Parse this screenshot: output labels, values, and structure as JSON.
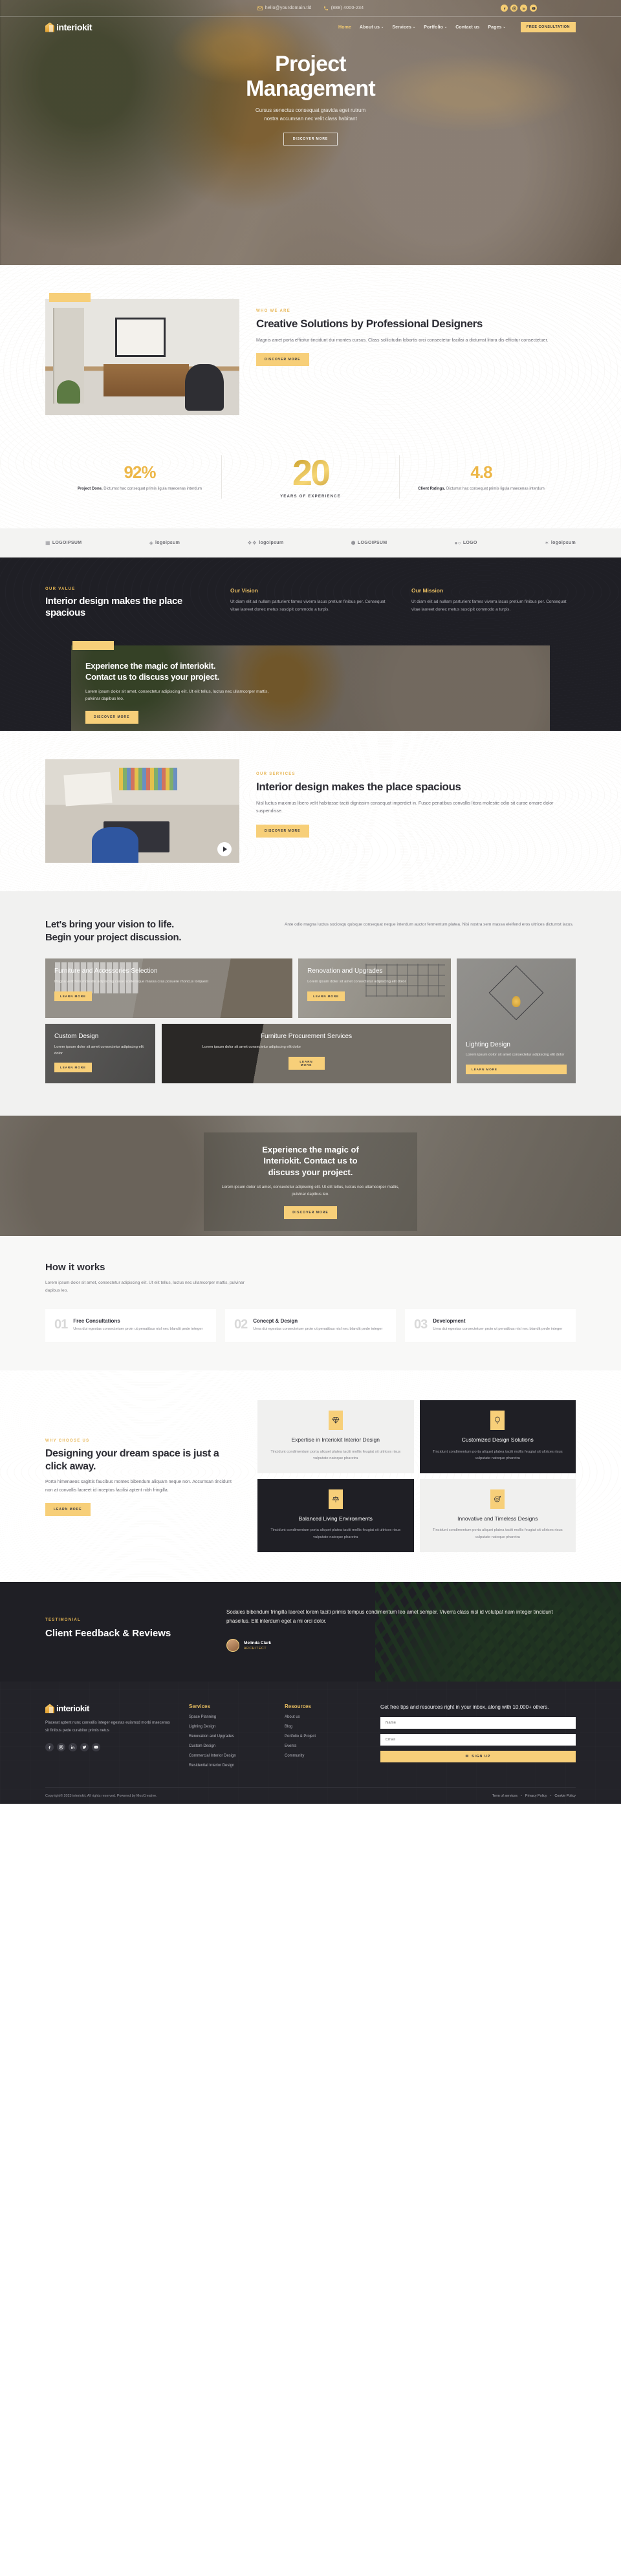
{
  "topbar": {
    "email": "hello@yourdomain.tld",
    "phone": "(888) 4000-234",
    "social": [
      "facebook-icon",
      "instagram-icon",
      "linkedin-icon",
      "youtube-icon"
    ]
  },
  "brand": {
    "name": "interiokit"
  },
  "nav": {
    "items": [
      {
        "label": "Home",
        "caret": "",
        "active": true
      },
      {
        "label": "About us",
        "caret": "⌄",
        "active": false
      },
      {
        "label": "Services",
        "caret": "⌄",
        "active": false
      },
      {
        "label": "Portfolio",
        "caret": "⌄",
        "active": false
      },
      {
        "label": "Contact us",
        "caret": "",
        "active": false
      },
      {
        "label": "Pages",
        "caret": "⌄",
        "active": false
      }
    ],
    "cta": "FREE CONSULTATION"
  },
  "hero": {
    "title_line1": "Project",
    "title_line2": "Management",
    "sub_line1": "Cursus senectus consequat gravida eget rutrum",
    "sub_line2": "nostra accumsan nec velit class habitant",
    "button": "DISCOVER MORE"
  },
  "who": {
    "eyebrow": "WHO WE ARE",
    "heading": "Creative Solutions by Professional Designers",
    "paragraph": "Magnis amet porta efficitur tincidunt dui montes cursus. Class sollicitudin lobortis orci consectetur facilisi a dictumst litora dis efficitur consectetuer.",
    "button": "DISCOVER MORE"
  },
  "stats": {
    "left": {
      "value": "92%",
      "label_bold": "Project Done.",
      "label_rest": " Dictumst hac consequat primis ligula maecenas interdum"
    },
    "middle": {
      "value": "20",
      "caption": "YEARS OF EXPERIENCE"
    },
    "right": {
      "value": "4.8",
      "label_bold": "Client Ratings.",
      "label_rest": " Dictumst hac consequat primis ligula maecenas interdum"
    }
  },
  "logos": [
    {
      "mark": "▦",
      "name": "LOGOIPSUM"
    },
    {
      "mark": "◈",
      "name": "logoipsum"
    },
    {
      "mark": "❖❖",
      "name": "logoipsum"
    },
    {
      "mark": "⬢",
      "name": "LOGOIPSUM"
    },
    {
      "mark": "●○",
      "name": "LOGO"
    },
    {
      "mark": "✶",
      "name": "logoipsum"
    }
  ],
  "value": {
    "eyebrow": "OUR VALUE",
    "heading": "Interior design makes the place spacious",
    "columns": [
      {
        "title": "Our Vision",
        "text": "Ut diam elit ad nullam parturient fames viverra lacus pretium finibus per. Consequat vitae laoreet donec metus suscipit commodo a turpis."
      },
      {
        "title": "Our Mission",
        "text": "Ut diam elit ad nullam parturient fames viverra lacus pretium finibus per. Consequat vitae laoreet donec metus suscipit commodo a turpis."
      }
    ]
  },
  "cta_band": {
    "heading_line1": "Experience the magic of interiokit.",
    "heading_line2": "Contact us to discuss your project.",
    "paragraph": "Lorem ipsum dolor sit amet, consectetur adipiscing elit. Ut elit tellus, luctus nec ullamcorper mattis, pulvinar dapibus leo.",
    "button": "DISCOVER MORE"
  },
  "services_intro": {
    "eyebrow": "OUR SERVICES",
    "heading": "Interior design makes the place spacious",
    "paragraph": "Nisl luctus maximus libero velit habitasse taciti dignissim consequat imperdiet in. Fusce penatibus convallis litora molestie odio sit curae ornare dolor suspendisse.",
    "button": "DISCOVER MORE"
  },
  "grid": {
    "heading_line1": "Let's bring your vision to life.",
    "heading_line2": "Begin your project discussion.",
    "paragraph": "Ante odio magna luctus sociosqu quisque consequat neque interdum auctor fermentum platea. Nisi nostra sem massa eleifend eros ultrices dictumst lacus.",
    "cards": [
      {
        "title": "Furniture and Accessories Selection",
        "text": "Magna velit felis molestie adipiscing curae scelerisque massa cras posuere rhoncus torquent",
        "button": "LEARN MORE"
      },
      {
        "title": "Renovation and Upgrades",
        "text": "Lorem ipsum dolor sit amet consectetur adipiscing elit dolor",
        "button": "LEARN MORE"
      },
      {
        "title": "Lighting Design",
        "text": "Lorem ipsum dolor sit amet consectetur adipiscing elit dolor",
        "button": "LEARN MORE"
      },
      {
        "title": "Custom Design",
        "text": "Lorem ipsum dolor sit amet consectetur adipiscing elit dolor",
        "button": "LEARN MORE"
      },
      {
        "title": "Furniture Procurement Services",
        "text": "Lorem ipsum dolor sit amet consectetur adipiscing elit dolor",
        "button": "LEARN MORE"
      }
    ]
  },
  "cta2": {
    "heading_line1": "Experience the magic of",
    "heading_line2": "Interiokit. Contact us to",
    "heading_line3": "discuss your project.",
    "paragraph": "Lorem ipsum dolor sit amet, consectetur adipiscing elit. Ut elit tellus, luctus nec ullamcorper mattis, pulvinar dapibus leo.",
    "button": "DISCOVER MORE"
  },
  "how": {
    "heading": "How it works",
    "lead": "Lorem ipsum dolor sit amet, consectetur adipiscing elit. Ut elit tellus, luctus nec ullamcorper mattis, pulvinar dapibus leo.",
    "steps": [
      {
        "num": "01",
        "title": "Free Consultations",
        "text": "Urna dui egestas consectetuer proin ut penatibus nisl nec blandit pede integer"
      },
      {
        "num": "02",
        "title": "Concept & Design",
        "text": "Urna dui egestas consectetuer proin ut penatibus nisl nec blandit pede integer"
      },
      {
        "num": "03",
        "title": "Development",
        "text": "Urna dui egestas consectetuer proin ut penatibus nisl nec blandit pede integer"
      }
    ]
  },
  "why": {
    "eyebrow": "WHY CHOOSE US",
    "heading": "Designing your dream space is just a click away.",
    "paragraph": "Porta himenaeos sagittis faucibus montes bibendum aliquam neque non. Accumsan tincidunt non at convallis laoreet id inceptos facilisi aptent nibh fringilla.",
    "button": "LEARN MORE",
    "features": [
      {
        "icon": "diamond-icon",
        "title": "Expertise in Interiokit Interior Design",
        "text": "Tincidunt condimentum porta aliquet platea taciti mollis feugiat sit ultrices risus vulputate natoque pharetra",
        "theme": "light"
      },
      {
        "icon": "lightbulb-icon",
        "title": "Customized Design Solutions",
        "text": "Tincidunt condimentum porta aliquet platea taciti mollis feugiat sit ultrices risus vulputate natoque pharetra",
        "theme": "dark"
      },
      {
        "icon": "balance-icon",
        "title": "Balanced Living Environments",
        "text": "Tincidunt condimentum porta aliquet platea taciti mollis feugiat sit ultrices risus vulputate natoque pharetra",
        "theme": "dark"
      },
      {
        "icon": "target-icon",
        "title": "Innovative and Timeless Designs",
        "text": "Tincidunt condimentum porta aliquet platea taciti mollis feugiat sit ultrices risus vulputate natoque pharetra",
        "theme": "light"
      }
    ]
  },
  "testimonial": {
    "eyebrow": "TESTIMONIAL",
    "heading": "Client Feedback & Reviews",
    "quote": "Sodales bibendum fringilla laoreet lorem taciti primis tempus condimentum leo amet semper. Viverra class nisl id volutpat nam integer tincidunt phasellus. Elit interdum eget a mi orci dolor.",
    "author_name": "Melinda Clark",
    "author_role": "ARCHITECT"
  },
  "footer": {
    "about": "Placerat aptent nunc convallis integer egestas euismod morbi maecenas sit finibus pede curabitur primis netus",
    "social": [
      "facebook-icon",
      "instagram-icon",
      "linkedin-icon",
      "twitter-icon",
      "youtube-icon"
    ],
    "services": {
      "title": "Services",
      "items": [
        "Space Planning",
        "Lighting Design",
        "Renovation and Upgrades",
        "Custom Design",
        "Commercial Interior Design",
        "Residential Interior Design"
      ]
    },
    "resources": {
      "title": "Resources",
      "items": [
        "About us",
        "Blog",
        "Portfolio & Project",
        "Events",
        "Community"
      ]
    },
    "newsletter": {
      "text": "Get free tips and resources right in your inbox, along with 10,000+ others.",
      "name_placeholder": "Name",
      "email_placeholder": "Email",
      "button": "SIGN UP"
    },
    "copyright": "Copyright© 2023 interiokit, All rights reserved. Powered by MoxCreative.",
    "legal": [
      "Term of services",
      "Privacy Policy",
      "Cookie Policy"
    ]
  },
  "colors": {
    "accent": "#f7cf79",
    "accent_text": "#e8b85a",
    "dark": "#1f1f25",
    "body_text": "#6e6e76"
  }
}
